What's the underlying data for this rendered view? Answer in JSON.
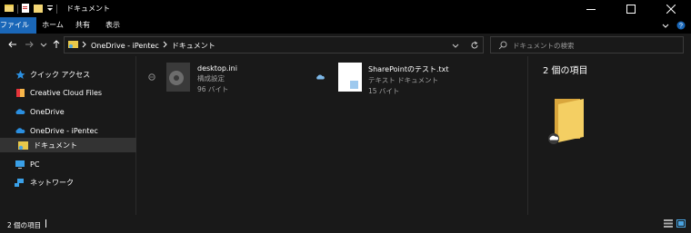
{
  "window": {
    "title": "ドキュメント",
    "minimize_icon": "minimize-icon",
    "maximize_icon": "maximize-icon",
    "close_icon": "close-icon"
  },
  "ribbon": {
    "tabs": [
      {
        "label": "ファイル",
        "active": true
      },
      {
        "label": "ホーム"
      },
      {
        "label": "共有"
      },
      {
        "label": "表示"
      }
    ],
    "accent_color": "#1a67b8"
  },
  "address": {
    "crumbs": [
      "OneDrive - iPentec",
      "ドキュメント"
    ]
  },
  "search": {
    "placeholder": "ドキュメントの検索"
  },
  "sidebar": {
    "items": [
      {
        "label": "クイック アクセス",
        "icon": "star-icon"
      },
      {
        "label": "Creative Cloud Files",
        "icon": "creative-cloud-icon"
      },
      {
        "label": "OneDrive",
        "icon": "cloud-icon"
      },
      {
        "label": "OneDrive - iPentec",
        "icon": "cloud-icon"
      },
      {
        "label": "ドキュメント",
        "icon": "documents-folder-icon",
        "selected": true
      },
      {
        "label": "PC",
        "icon": "pc-icon"
      },
      {
        "label": "ネットワーク",
        "icon": "network-icon"
      }
    ]
  },
  "files": [
    {
      "name": "desktop.ini",
      "type": "構成設定",
      "size": "96 バイト",
      "icon": "settings-file-icon"
    },
    {
      "name": "SharePointのテスト.txt",
      "type": "テキスト ドキュメント",
      "size": "15 バイト",
      "icon": "text-file-icon"
    }
  ],
  "preview": {
    "title": "2 個の項目"
  },
  "status": {
    "text": "2 個の項目"
  }
}
